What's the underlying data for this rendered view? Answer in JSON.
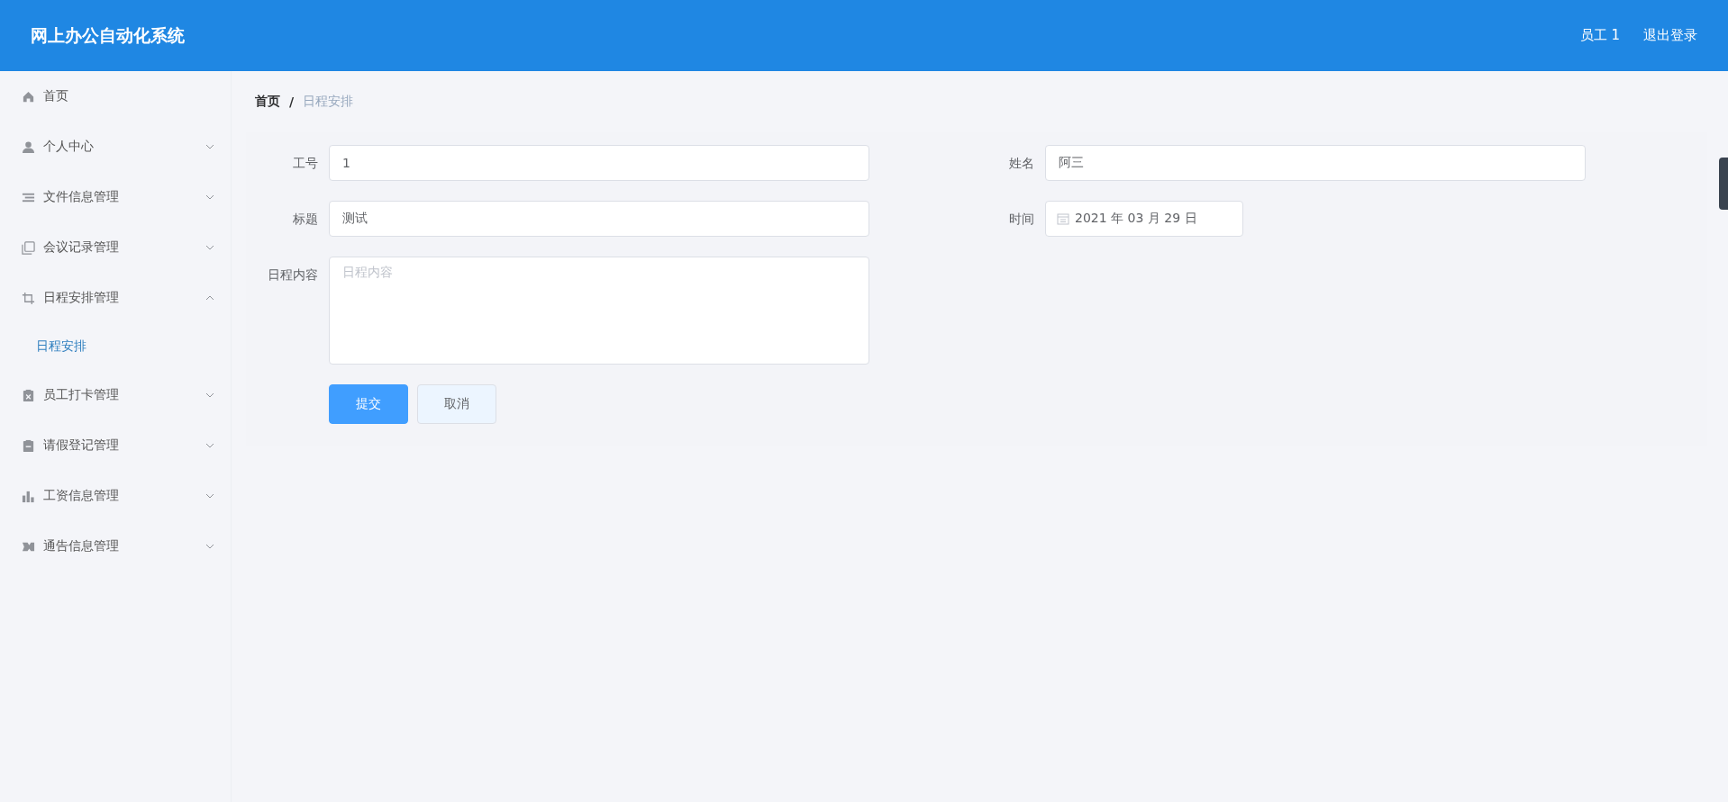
{
  "header": {
    "title": "网上办公自动化系统",
    "user": "员工 1",
    "logout": "退出登录"
  },
  "sidebar": {
    "items": [
      {
        "label": "首页",
        "kind": "link"
      },
      {
        "label": "个人中心",
        "kind": "group",
        "expanded": false
      },
      {
        "label": "文件信息管理",
        "kind": "group",
        "expanded": false
      },
      {
        "label": "会议记录管理",
        "kind": "group",
        "expanded": false
      },
      {
        "label": "日程安排管理",
        "kind": "group",
        "expanded": true,
        "children": [
          {
            "label": "日程安排",
            "selected": true
          }
        ]
      },
      {
        "label": "员工打卡管理",
        "kind": "group",
        "expanded": false
      },
      {
        "label": "请假登记管理",
        "kind": "group",
        "expanded": false
      },
      {
        "label": "工资信息管理",
        "kind": "group",
        "expanded": false
      },
      {
        "label": "通告信息管理",
        "kind": "group",
        "expanded": false
      }
    ]
  },
  "breadcrumb": {
    "separator": "/",
    "items": [
      {
        "label": "首页"
      },
      {
        "label": "日程安排"
      }
    ]
  },
  "form": {
    "fields": [
      {
        "label": "工号",
        "value": "1",
        "kind": "text"
      },
      {
        "label": "姓名",
        "value": "阿三",
        "kind": "text"
      },
      {
        "label": "标题",
        "value": "测试",
        "kind": "text"
      },
      {
        "label": "时间",
        "value": "2021 年 03 月 29 日",
        "kind": "date"
      },
      {
        "label": "日程内容",
        "placeholder": "日程内容",
        "kind": "textarea"
      }
    ],
    "buttons": [
      {
        "label": "提交",
        "kind": "primary"
      },
      {
        "label": "取消",
        "kind": "secondary"
      }
    ]
  }
}
